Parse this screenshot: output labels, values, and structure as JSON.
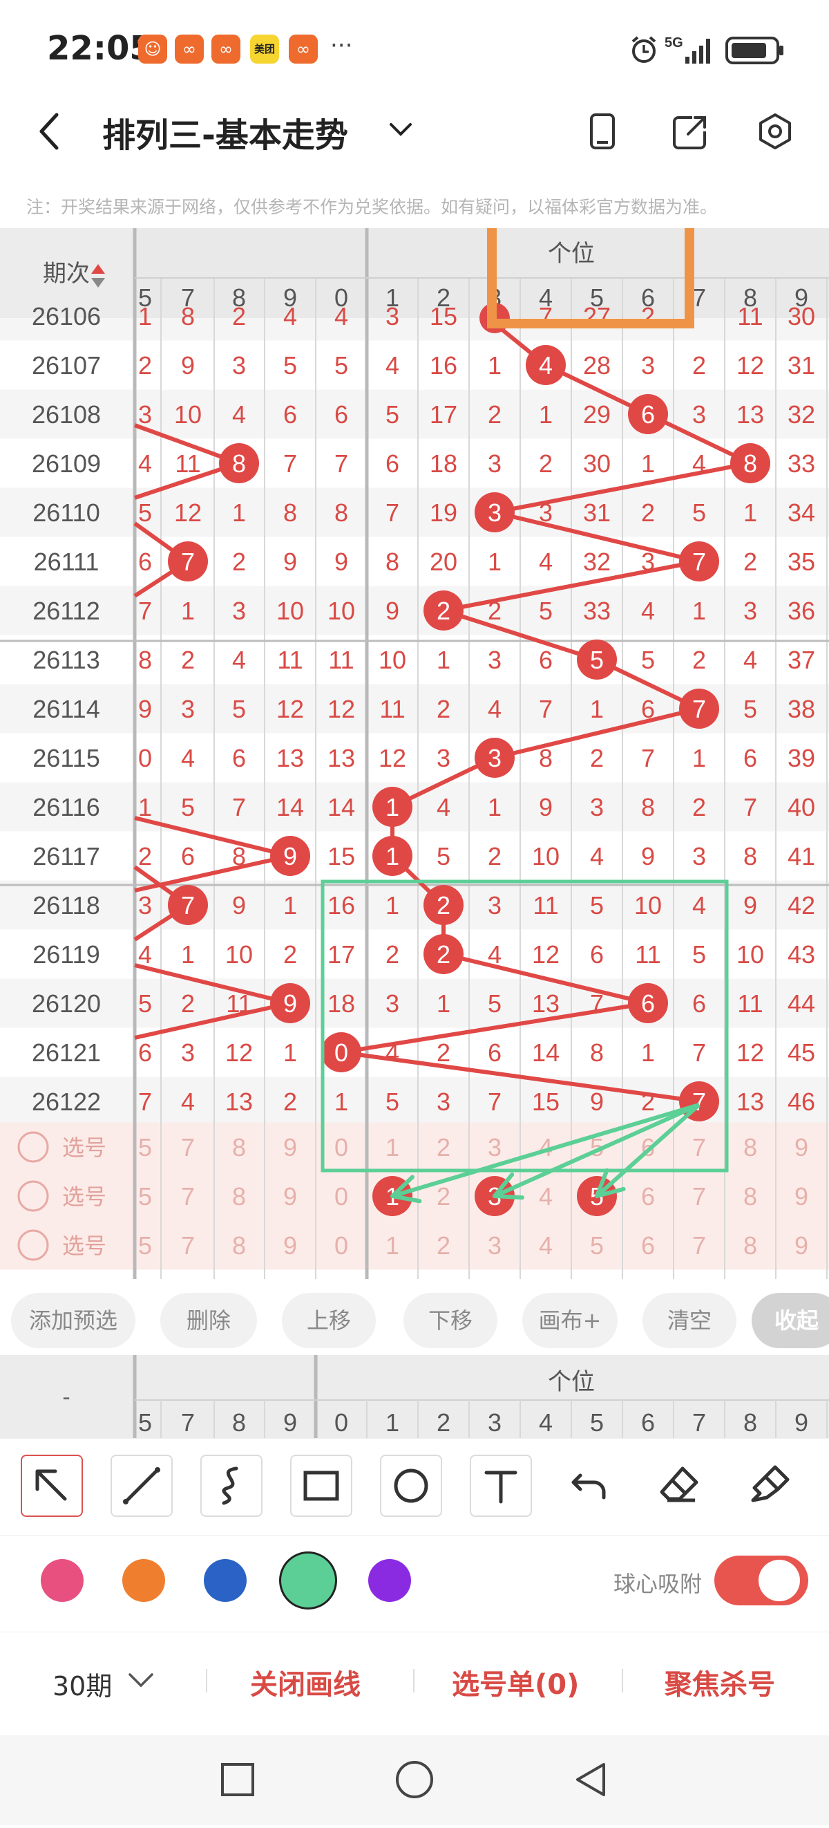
{
  "status_bar": {
    "time": "22:05",
    "apps": [
      "shop-app",
      "kuaishou-app",
      "kuaishou-app",
      "meituan-app",
      "kuaishou-app"
    ],
    "meituan_label": "美团",
    "more": "···",
    "network": "5G"
  },
  "header": {
    "title": "排列三-基本走势",
    "notice": "注：开奖结果来源于网络，仅供参考不作为兑奖依据。如有疑问，以福体彩官方数据为准。"
  },
  "table": {
    "issue_header": "期次",
    "group_label": "个位",
    "left_cols": [
      "5",
      "7",
      "8",
      "9"
    ],
    "main_cols": [
      "0",
      "1",
      "2",
      "3",
      "4",
      "5",
      "6",
      "7",
      "8",
      "9"
    ],
    "partial_row": {
      "issue": "26106",
      "left": [
        "1",
        "8",
        "2",
        "4"
      ],
      "main": [
        "4",
        "3",
        "15",
        "",
        "7",
        "27",
        "2",
        "",
        "11",
        "30"
      ]
    },
    "rows": [
      {
        "issue": "26107",
        "left": [
          "2",
          "9",
          "3",
          "5"
        ],
        "main": [
          "5",
          "4",
          "16",
          "1",
          "4",
          "28",
          "3",
          "2",
          "12",
          "31"
        ]
      },
      {
        "issue": "26108",
        "left": [
          "3",
          "10",
          "4",
          "6"
        ],
        "main": [
          "6",
          "5",
          "17",
          "2",
          "1",
          "29",
          "6",
          "3",
          "13",
          "32"
        ]
      },
      {
        "issue": "26109",
        "left": [
          "4",
          "11",
          "8",
          "7"
        ],
        "main": [
          "7",
          "6",
          "18",
          "3",
          "2",
          "30",
          "1",
          "4",
          "8",
          "33"
        ]
      },
      {
        "issue": "26110",
        "left": [
          "5",
          "12",
          "1",
          "8"
        ],
        "main": [
          "8",
          "7",
          "19",
          "3",
          "3",
          "31",
          "2",
          "5",
          "1",
          "34"
        ]
      },
      {
        "issue": "26111",
        "left": [
          "6",
          "7",
          "2",
          "9"
        ],
        "main": [
          "9",
          "8",
          "20",
          "1",
          "4",
          "32",
          "3",
          "7",
          "2",
          "35"
        ]
      },
      {
        "issue": "26112",
        "left": [
          "7",
          "1",
          "3",
          "10"
        ],
        "main": [
          "10",
          "9",
          "2",
          "2",
          "5",
          "33",
          "4",
          "1",
          "3",
          "36"
        ]
      },
      {
        "issue": "26113",
        "left": [
          "8",
          "2",
          "4",
          "11"
        ],
        "main": [
          "11",
          "10",
          "1",
          "3",
          "6",
          "5",
          "5",
          "2",
          "4",
          "37"
        ]
      },
      {
        "issue": "26114",
        "left": [
          "9",
          "3",
          "5",
          "12"
        ],
        "main": [
          "12",
          "11",
          "2",
          "4",
          "7",
          "1",
          "6",
          "7",
          "5",
          "38"
        ]
      },
      {
        "issue": "26115",
        "left": [
          "0",
          "4",
          "6",
          "13"
        ],
        "main": [
          "13",
          "12",
          "3",
          "3",
          "8",
          "2",
          "7",
          "1",
          "6",
          "39"
        ]
      },
      {
        "issue": "26116",
        "left": [
          "1",
          "5",
          "7",
          "14"
        ],
        "main": [
          "14",
          "1",
          "4",
          "1",
          "9",
          "3",
          "8",
          "2",
          "7",
          "40"
        ]
      },
      {
        "issue": "26117",
        "left": [
          "2",
          "6",
          "8",
          "9"
        ],
        "main": [
          "15",
          "1",
          "5",
          "2",
          "10",
          "4",
          "9",
          "3",
          "8",
          "41"
        ]
      },
      {
        "issue": "26118",
        "left": [
          "3",
          "7",
          "9",
          "1"
        ],
        "main": [
          "16",
          "1",
          "2",
          "3",
          "11",
          "5",
          "10",
          "4",
          "9",
          "42"
        ]
      },
      {
        "issue": "26119",
        "left": [
          "4",
          "1",
          "10",
          "2"
        ],
        "main": [
          "17",
          "2",
          "2",
          "4",
          "12",
          "6",
          "11",
          "5",
          "10",
          "43"
        ]
      },
      {
        "issue": "26120",
        "left": [
          "5",
          "2",
          "11",
          "9"
        ],
        "main": [
          "18",
          "3",
          "1",
          "5",
          "13",
          "7",
          "6",
          "6",
          "11",
          "44"
        ]
      },
      {
        "issue": "26121",
        "left": [
          "6",
          "3",
          "12",
          "1"
        ],
        "main": [
          "0",
          "4",
          "2",
          "6",
          "14",
          "8",
          "1",
          "7",
          "12",
          "45"
        ]
      },
      {
        "issue": "26122",
        "left": [
          "7",
          "4",
          "13",
          "2"
        ],
        "main": [
          "1",
          "5",
          "3",
          "7",
          "15",
          "9",
          "2",
          "7",
          "13",
          "46"
        ]
      }
    ],
    "highlight_left": [
      null,
      null,
      2,
      null,
      1,
      null,
      null,
      null,
      null,
      null,
      3,
      1,
      null,
      3,
      null,
      null
    ],
    "highlight_main": [
      4,
      6,
      8,
      3,
      7,
      2,
      5,
      7,
      3,
      1,
      1,
      2,
      2,
      6,
      0,
      7
    ],
    "pick_label": "选号",
    "pick_left": [
      "5",
      "7",
      "8",
      "9"
    ],
    "pick_main": [
      "0",
      "1",
      "2",
      "3",
      "4",
      "5",
      "6",
      "7",
      "8",
      "9"
    ],
    "pick_selected": [
      1,
      3,
      5
    ]
  },
  "toolbar": {
    "buttons": [
      "添加预选",
      "删除",
      "上移",
      "下移",
      "画布+",
      "清空",
      "收起"
    ]
  },
  "bottom_header": {
    "dash": "-",
    "group_label": "个位"
  },
  "tools": [
    "pointer-tool",
    "line-tool",
    "curve-tool",
    "rectangle-tool",
    "circle-tool",
    "text-tool",
    "undo-tool",
    "eraser-tool",
    "brush-tool"
  ],
  "colors": {
    "palette": [
      "#e8507f",
      "#ef7f2f",
      "#2a62c6",
      "#5ccf96",
      "#8a2be2"
    ],
    "selected_palette_index": 3,
    "accent": "#e04846",
    "ball": "#e04846",
    "grid_red": "#d94a45",
    "annotation_orange": "#ef9447",
    "annotation_green": "#5ccf96"
  },
  "snap": {
    "label": "球心吸附",
    "on": true
  },
  "actions": {
    "period": "30期",
    "close_lines": "关闭画线",
    "pick_list": "选号单(0)",
    "focus_kill": "聚焦杀号"
  }
}
